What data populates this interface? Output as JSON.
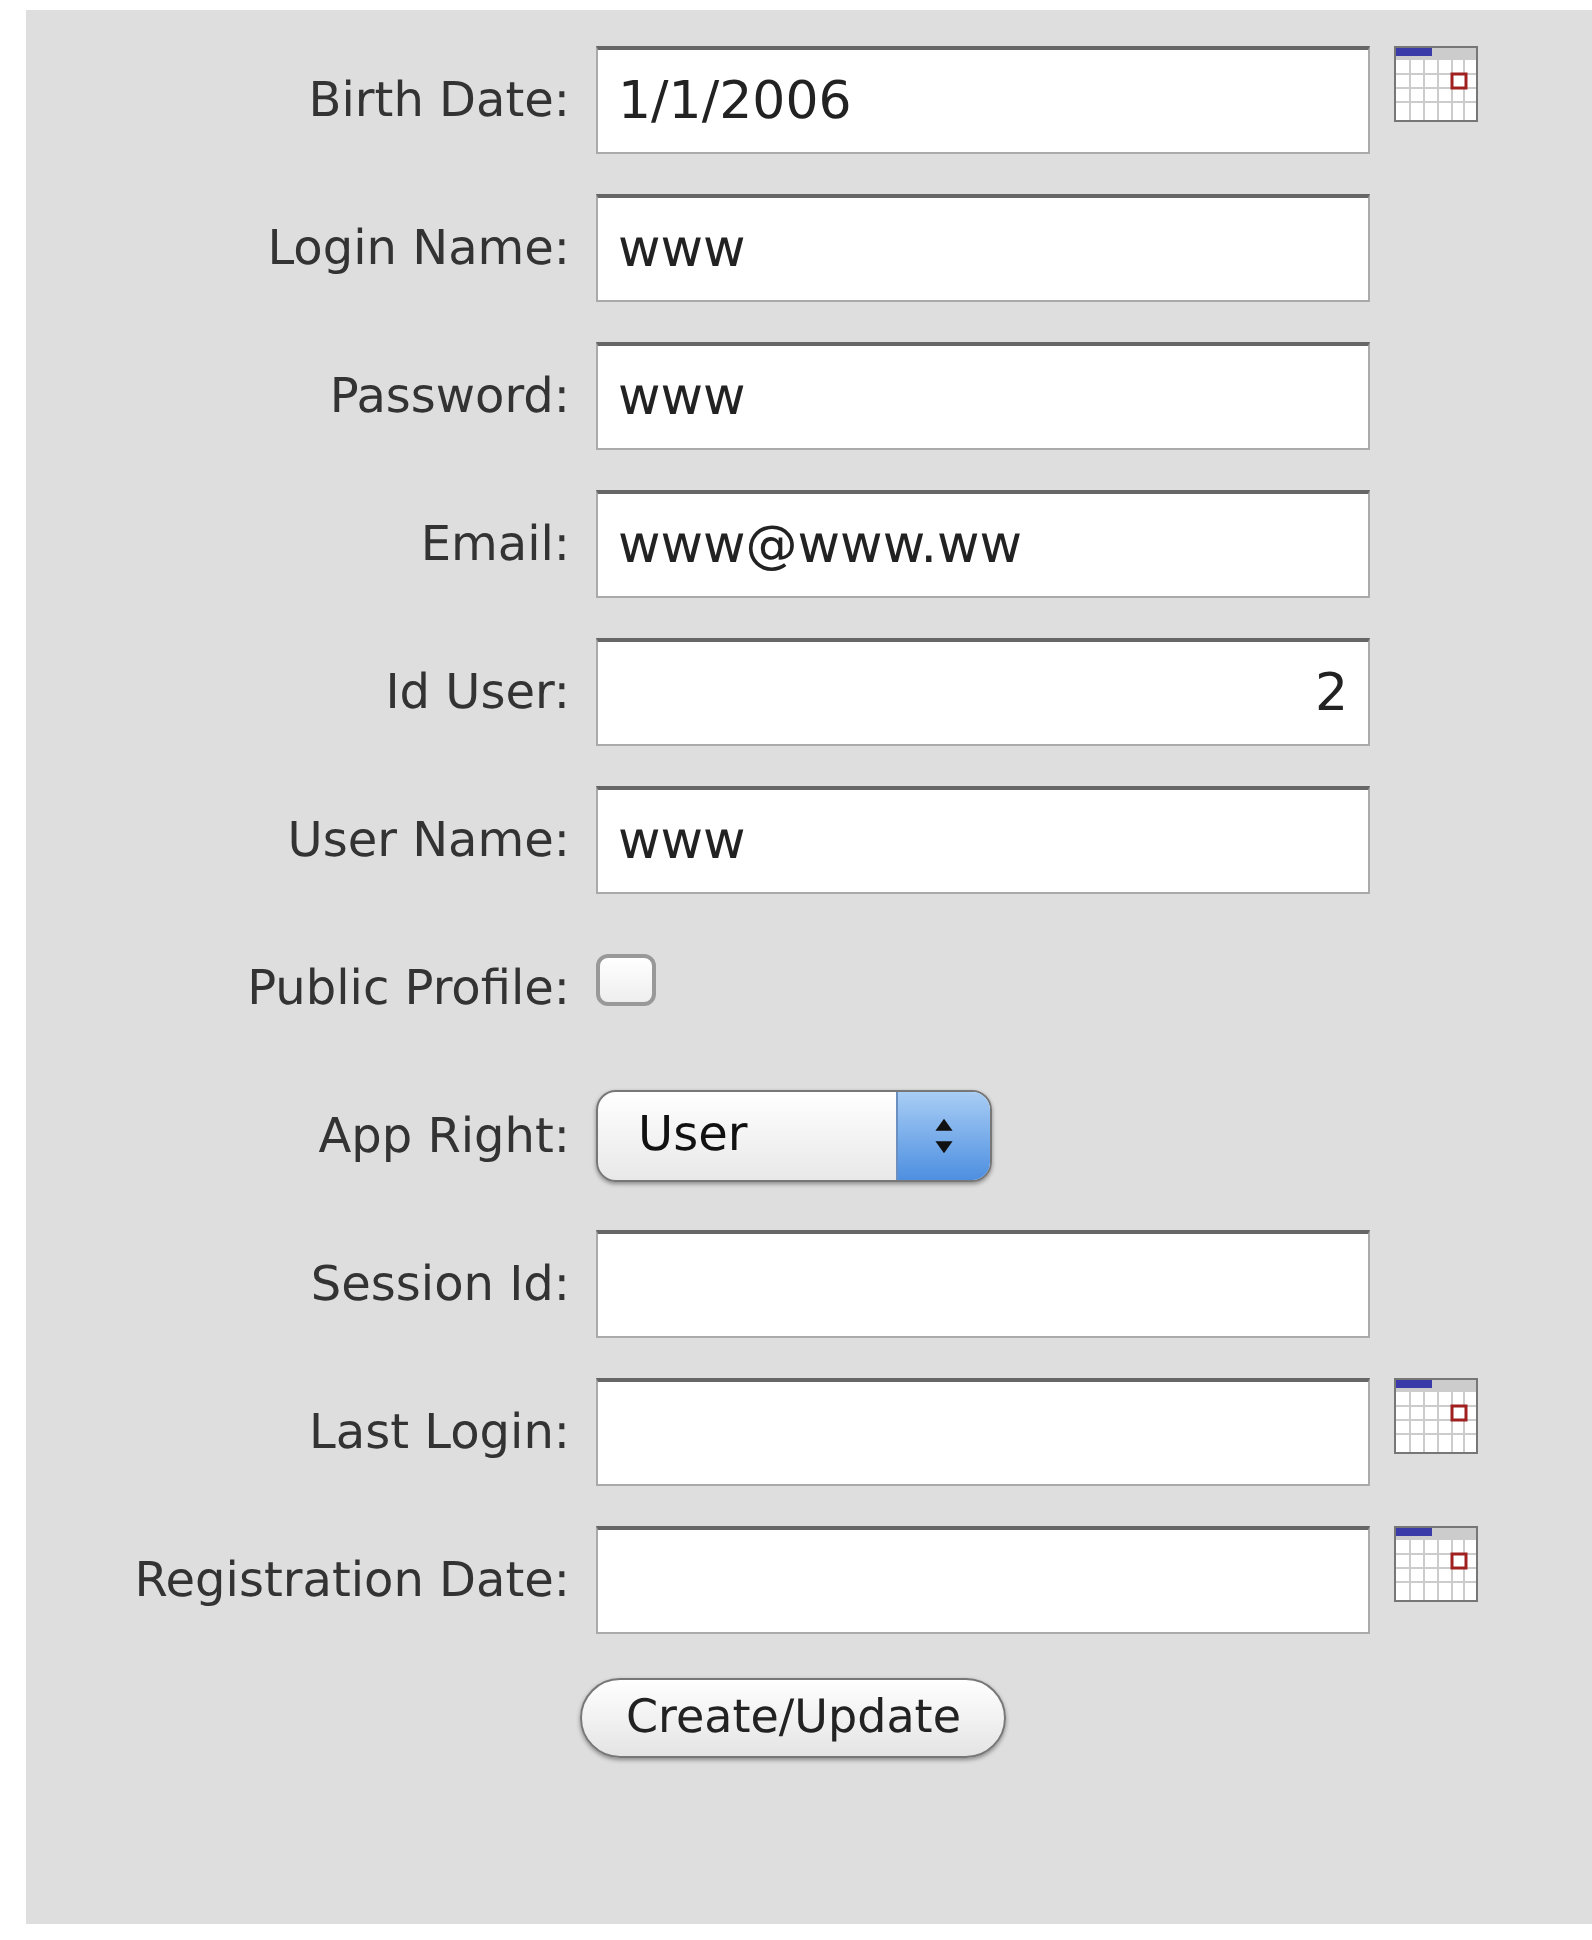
{
  "fields": [
    {
      "kind": "date",
      "label": "Birth Date:",
      "value": "1/1/2006"
    },
    {
      "kind": "text",
      "label": "Login Name:",
      "value": "www"
    },
    {
      "kind": "text",
      "label": "Password:",
      "value": "www"
    },
    {
      "kind": "text",
      "label": "Email:",
      "value": "www@www.ww"
    },
    {
      "kind": "number",
      "label": "Id User:",
      "value": "2"
    },
    {
      "kind": "text",
      "label": "User Name:",
      "value": "www"
    },
    {
      "kind": "checkbox",
      "label": "Public Profile:",
      "checked": false
    },
    {
      "kind": "select",
      "label": "App Right:",
      "value": "User"
    },
    {
      "kind": "text",
      "label": "Session Id:"
    },
    {
      "kind": "date",
      "label": "Last Login:"
    },
    {
      "kind": "date",
      "label": "Registration Date:"
    }
  ],
  "submit_button": "Create/Update"
}
